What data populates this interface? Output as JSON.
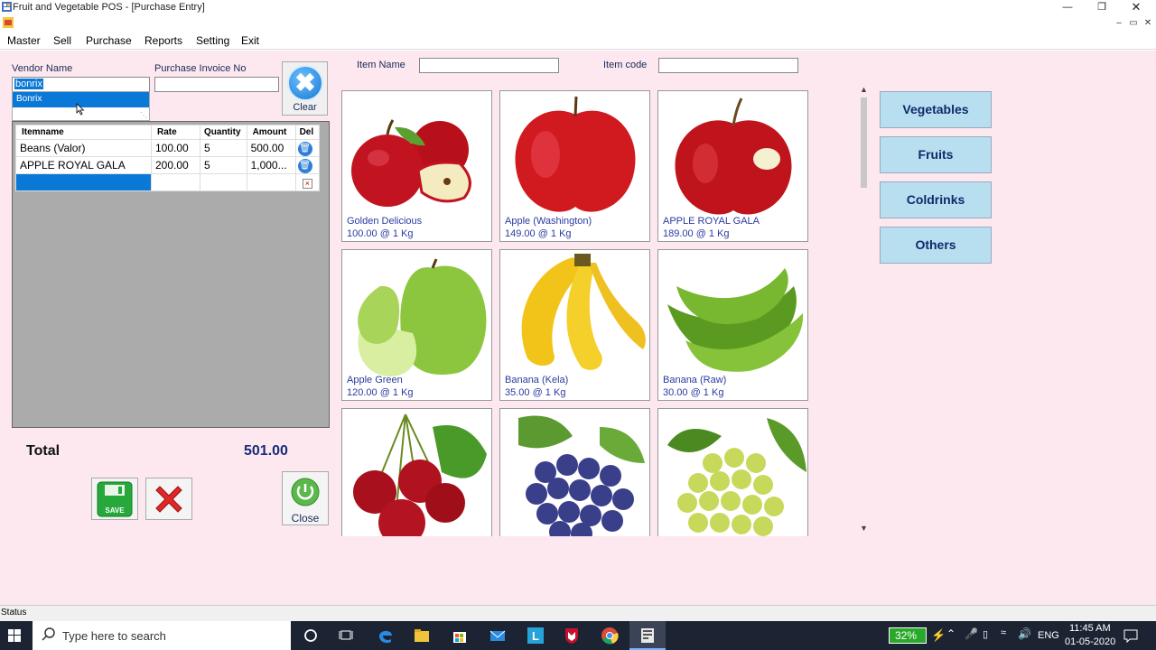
{
  "window": {
    "title": "Fruit and Vegetable POS - [Purchase Entry]"
  },
  "menu": [
    "Master",
    "Sell",
    "Purchase",
    "Reports",
    "Setting",
    "Exit"
  ],
  "form": {
    "vendor_label": "Vendor Name",
    "vendor_value": "bonrix",
    "vendor_suggestion": "Bonrix",
    "invoice_label": "Purchase Invoice No",
    "invoice_value": "",
    "clear_label": "Clear",
    "item_name_label": "Item Name",
    "item_code_label": "Item code"
  },
  "grid": {
    "columns": [
      "Itemname",
      "Rate",
      "Quantity",
      "Amount",
      "Del"
    ],
    "rows": [
      {
        "item": "Beans (Valor)",
        "rate": "100.00",
        "qty": "5",
        "amount": "500.00"
      },
      {
        "item": "APPLE ROYAL GALA",
        "rate": "200.00",
        "qty": "5",
        "amount": "1,000..."
      }
    ]
  },
  "totals": {
    "label": "Total",
    "value": "501.00"
  },
  "actions": {
    "save_label": "SAVE",
    "close_label": "Close"
  },
  "products": [
    {
      "name": "Golden Delicious",
      "price": "100.00 @ 1 Kg"
    },
    {
      "name": "Apple (Washington)",
      "price": "149.00 @ 1 Kg"
    },
    {
      "name": "APPLE ROYAL GALA",
      "price": "189.00 @ 1 Kg"
    },
    {
      "name": "Apple Green",
      "price": "120.00 @ 1 Kg"
    },
    {
      "name": "Banana (Kela)",
      "price": "35.00 @ 1 Kg"
    },
    {
      "name": "Banana (Raw)",
      "price": "30.00 @ 1 Kg"
    }
  ],
  "categories": [
    "Vegetables",
    "Fruits",
    "Coldrinks",
    "Others"
  ],
  "status": "Status",
  "taskbar": {
    "search_placeholder": "Type here to search",
    "battery": "32%",
    "lang": "ENG",
    "time": "11:45 AM",
    "date": "01-05-2020"
  }
}
